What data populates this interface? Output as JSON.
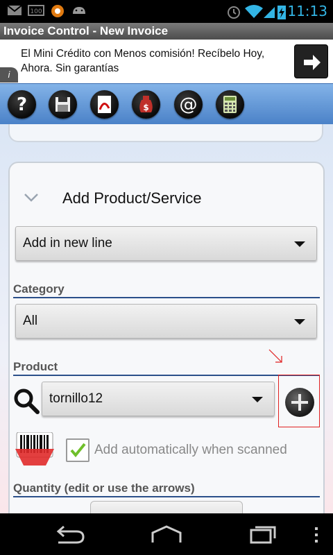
{
  "status_bar": {
    "time": "11:13",
    "left_icons": [
      "gmail-icon",
      "battery-100-icon",
      "avast-icon",
      "android-icon"
    ],
    "right_icons": [
      "alarm-icon",
      "wifi-icon",
      "battery-charging-icon",
      "signal-icon"
    ]
  },
  "title_bar": {
    "title": "Invoice Control - New Invoice"
  },
  "ad": {
    "text": "El Mini Crédito con Menos comisión! Recíbelo Hoy, Ahora. Sin garantías",
    "info_label": "i"
  },
  "toolbar": {
    "buttons": [
      "help-icon",
      "save-icon",
      "pdf-icon",
      "money-bag-icon",
      "email-icon",
      "calculator-icon"
    ]
  },
  "add_product": {
    "title": "Add Product/Service",
    "line_mode": {
      "selected": "Add in new line"
    },
    "category": {
      "label": "Category",
      "selected": "All"
    },
    "product": {
      "label": "Product",
      "selected": "tornillo12"
    },
    "auto_add": {
      "label": "Add automatically when scanned",
      "checked": true
    },
    "quantity": {
      "label": "Quantity (edit or use the arrows)"
    }
  },
  "colors": {
    "accent": "#33b5e5",
    "toolbar": "#5a8fd4",
    "section_rule": "#2b4f8a",
    "highlight": "#e02020"
  }
}
